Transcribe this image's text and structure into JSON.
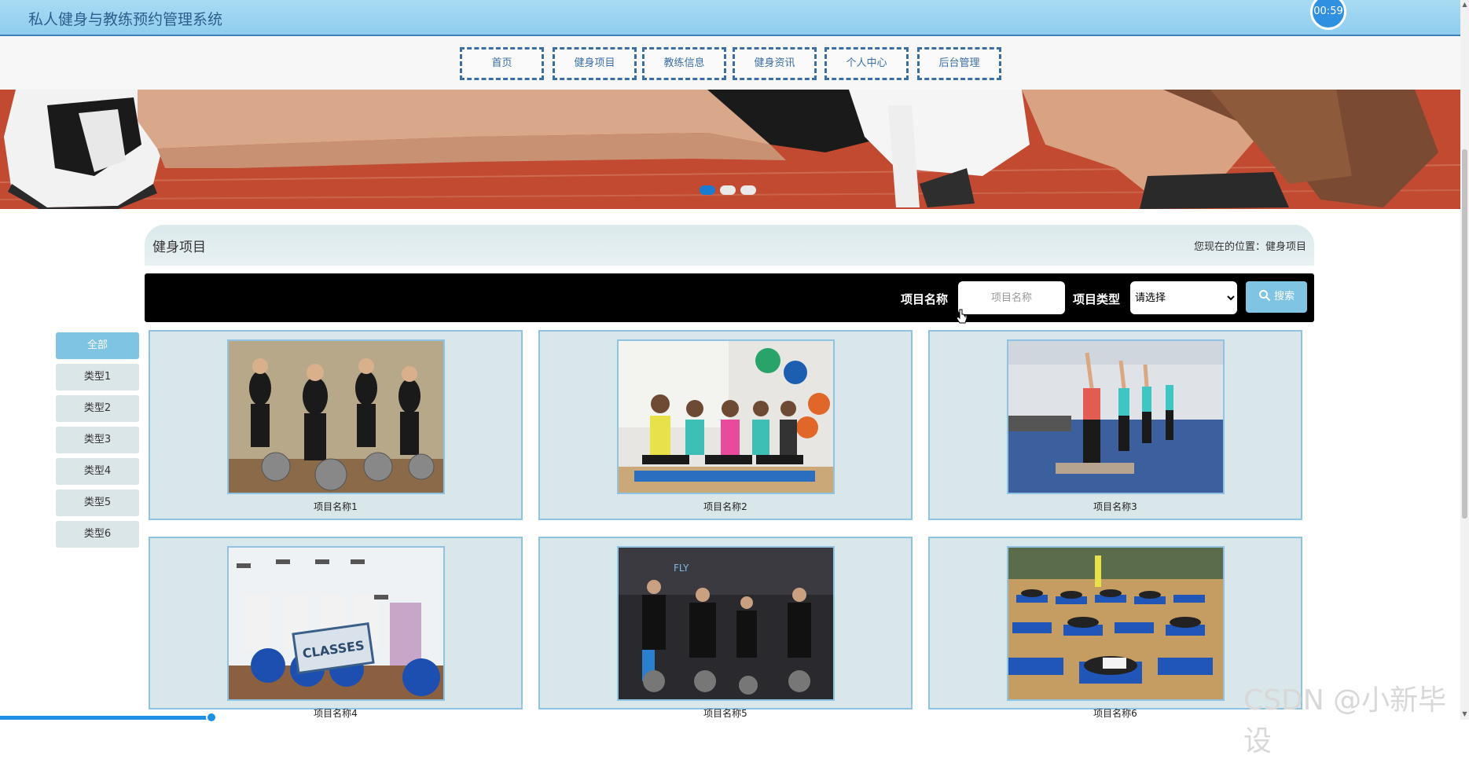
{
  "header": {
    "title": "私人健身与教练预约管理系统",
    "timer": "00:59"
  },
  "nav": {
    "items": [
      {
        "label": "首页"
      },
      {
        "label": "健身项目"
      },
      {
        "label": "教练信息"
      },
      {
        "label": "健身资讯"
      },
      {
        "label": "个人中心"
      },
      {
        "label": "后台管理"
      }
    ]
  },
  "banner": {
    "slide_count": 3,
    "active_slide": 1,
    "active_color": "#1a7bd0"
  },
  "section": {
    "title": "健身项目",
    "breadcrumb": "您现在的位置：健身项目"
  },
  "search": {
    "name_label": "项目名称",
    "name_placeholder": "项目名称",
    "name_value": "",
    "type_label": "项目类型",
    "type_selected": "请选择",
    "button_label": "搜索",
    "button_icon": "search-icon"
  },
  "categories": [
    {
      "label": "全部",
      "active": true
    },
    {
      "label": "类型1",
      "active": false
    },
    {
      "label": "类型2",
      "active": false
    },
    {
      "label": "类型3",
      "active": false
    },
    {
      "label": "类型4",
      "active": false
    },
    {
      "label": "类型5",
      "active": false
    },
    {
      "label": "类型6",
      "active": false
    }
  ],
  "projects": [
    {
      "name": "项目名称1"
    },
    {
      "name": "项目名称2"
    },
    {
      "name": "项目名称3"
    },
    {
      "name": "项目名称4"
    },
    {
      "name": "项目名称5"
    },
    {
      "name": "项目名称6"
    }
  ],
  "watermark": "CSDN @小新毕设",
  "colors": {
    "accent": "#7fc4e3",
    "nav_border": "#3a6ea5",
    "header_bg": "#a9dbf4"
  }
}
